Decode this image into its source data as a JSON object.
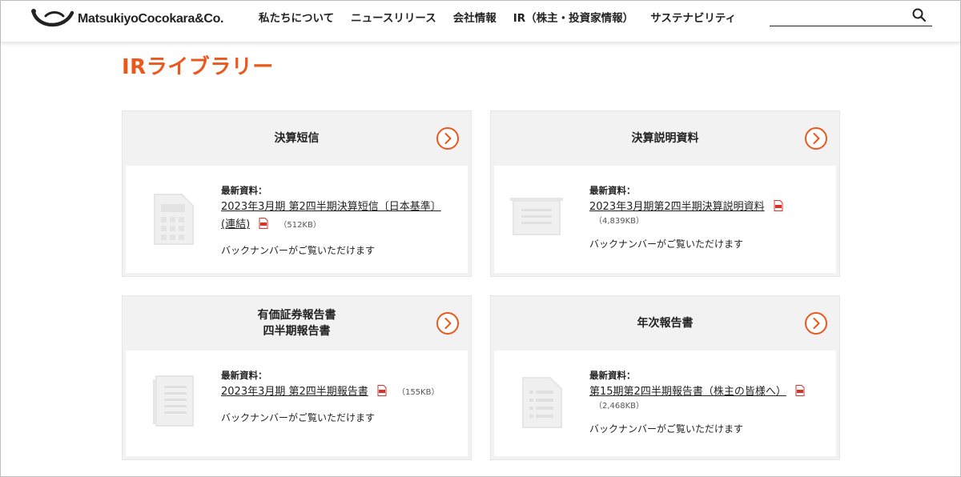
{
  "brand": {
    "name": "MatsukiyoCocokara&Co.",
    "accent_color": "#e9591e"
  },
  "nav": {
    "items": [
      "私たちについて",
      "ニュースリリース",
      "会社情報",
      "IR（株主・投資家情報）",
      "サステナビリティ"
    ]
  },
  "search": {
    "placeholder": "",
    "icon": "search-icon"
  },
  "page": {
    "title": "IRライブラリー"
  },
  "cards": [
    {
      "title": "決算短信",
      "latest_label": "最新資料：",
      "doc_title": "2023年3月期 第2四半期決算短信〔日本基準〕(連結)",
      "doc_size": "（512KB）",
      "backnumber": "バックナンバーがご覧いただけます"
    },
    {
      "title": "決算説明資料",
      "latest_label": "最新資料：",
      "doc_title": "2023年3月期第2四半期決算説明資料",
      "doc_size": "（4,839KB）",
      "backnumber": "バックナンバーがご覧いただけます"
    },
    {
      "title_line1": "有価証券報告書",
      "title_line2": "四半期報告書",
      "latest_label": "最新資料：",
      "doc_title": "2023年3月期 第2四半期報告書",
      "doc_size": "（155KB）",
      "backnumber": "バックナンバーがご覧いただけます"
    },
    {
      "title": "年次報告書",
      "latest_label": "最新資料：",
      "doc_title": "第15期第2四半期報告書（株主の皆様へ）",
      "doc_size": "（2,468KB）",
      "backnumber": "バックナンバーがご覧いただけます"
    }
  ]
}
